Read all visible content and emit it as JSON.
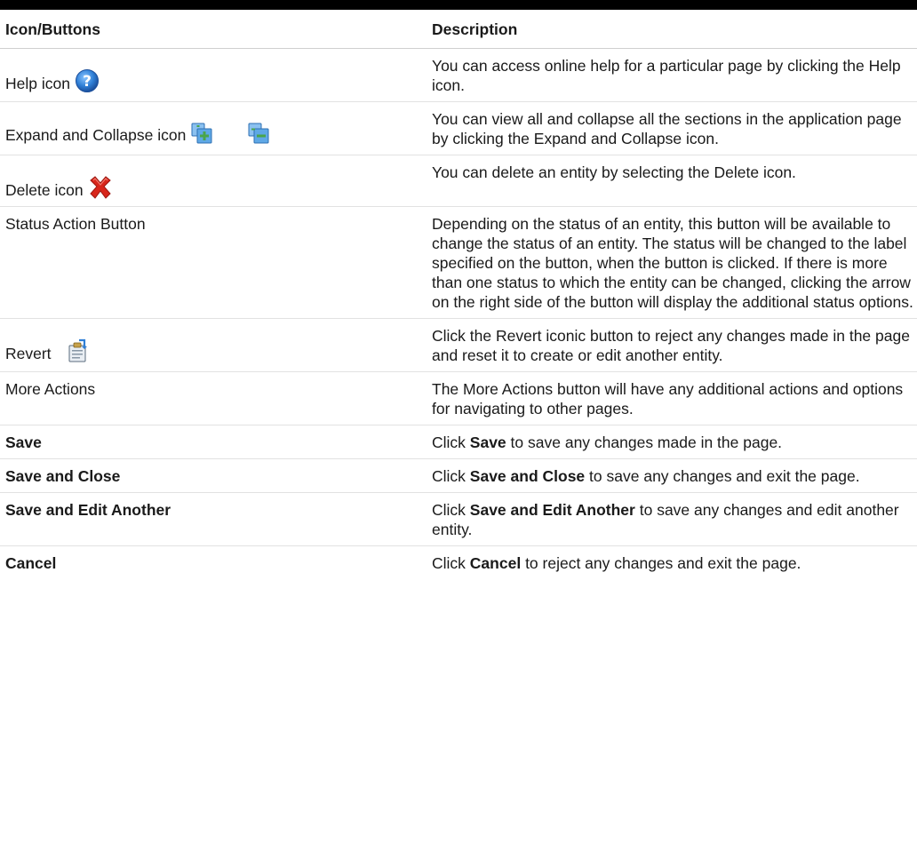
{
  "table": {
    "header": {
      "col1": "Icon/Buttons",
      "col2": "Description"
    },
    "rows": [
      {
        "label": "Help icon",
        "icons": [
          "help-icon"
        ],
        "desc": "You can access online help for a particular page by clicking the Help icon."
      },
      {
        "label": "Expand and Collapse icon",
        "icons": [
          "expand-all-icon",
          "collapse-all-icon"
        ],
        "desc": "You can view all and collapse all the sections in the application page by clicking the Expand and Collapse icon."
      },
      {
        "label": "Delete icon",
        "icons": [
          "delete-icon"
        ],
        "desc": "You can delete an entity by selecting the Delete icon."
      },
      {
        "label": "Status Action Button",
        "desc": "Depending on the status of an entity, this button will be available to change the status of an entity. The status will be changed to the label specified on the button, when the button is clicked. If there is more than one status to which the entity can be changed, clicking the arrow on the right side of the button will display the additional status options."
      },
      {
        "label": "Revert",
        "icons": [
          "revert-icon"
        ],
        "desc": "Click the Revert iconic button to reject any changes made in the page and reset it to create or edit another entity."
      },
      {
        "label": "More Actions",
        "desc": "The More Actions button will have any additional actions and options for navigating to other pages."
      },
      {
        "label": "Save",
        "desc_pre": "Click",
        "desc_bold": "Save",
        "desc_post": "to save any changes made in the page."
      },
      {
        "label": "Save and Close",
        "desc_pre": "Click",
        "desc_bold": "Save and Close",
        "desc_post": "to save any changes and exit the page."
      },
      {
        "label": "Save and Edit Another",
        "desc_pre": "Click",
        "desc_bold": "Save and Edit Another",
        "desc_post": "to save any changes and edit another entity."
      },
      {
        "label": "Cancel",
        "desc_pre": "Click",
        "desc_bold": "Cancel",
        "desc_post": "to reject any changes and exit the page."
      }
    ]
  },
  "colors": {
    "rule": "#000000",
    "help_blue": "#2f7fd6",
    "delete_red": "#d8261b",
    "expand_blue": "#3c86c9",
    "expand_green": "#4aa54a"
  }
}
